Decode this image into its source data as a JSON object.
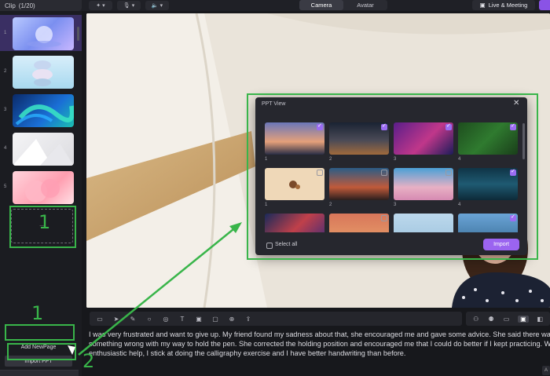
{
  "top_bar": {
    "clip_label": "Clip",
    "clip_count": "(1/20)",
    "tools": [
      {
        "icon": "effects-icon"
      },
      {
        "icon": "microphone-icon"
      },
      {
        "icon": "speaker-icon"
      }
    ],
    "mode_tabs": [
      "Camera",
      "Avatar"
    ],
    "active_mode": "Camera",
    "live_label": "Live & Meeting"
  },
  "sidebar": {
    "slides": [
      {
        "number": "1",
        "selected": true
      },
      {
        "number": "2",
        "selected": false
      },
      {
        "number": "3",
        "selected": false
      },
      {
        "number": "4",
        "selected": false
      },
      {
        "number": "5",
        "selected": false
      }
    ],
    "add_page_label": "Add NewPage",
    "import_ppt_label": "Import PPT",
    "plus_label": "+"
  },
  "annotations": {
    "marker_1_empty_slot": "1",
    "marker_1_buttons": "1",
    "marker_2": "2"
  },
  "ppt_dialog": {
    "title": "PPT View",
    "close_glyph": "✕",
    "slides": [
      {
        "label": "1",
        "checked": true
      },
      {
        "label": "2",
        "checked": true
      },
      {
        "label": "3",
        "checked": true
      },
      {
        "label": "4",
        "checked": true
      },
      {
        "label": "1",
        "checked": false
      },
      {
        "label": "2",
        "checked": false
      },
      {
        "label": "3",
        "checked": false
      },
      {
        "label": "4",
        "checked": true
      },
      {
        "label": "",
        "checked": false
      },
      {
        "label": "",
        "checked": false
      },
      {
        "label": "",
        "checked": false
      },
      {
        "label": "",
        "checked": true
      }
    ],
    "select_all_label": "Select all",
    "import_label": "Import"
  },
  "toolbar": {
    "tools": [
      "caption-icon",
      "pointer-icon",
      "pen-icon",
      "search-icon",
      "focus-icon",
      "text-icon",
      "image-icon",
      "screen-icon",
      "add-icon",
      "import-icon"
    ],
    "view_tools": [
      "person-icon",
      "people-icon",
      "display-icon",
      "layout-icon",
      "split-icon"
    ]
  },
  "script": {
    "text": "I was very frustrated and want to give up. My friend found my sadness about that, she encouraged me and gave some advice. She said there was something wrong with my way to hold the pen. She corrected the holding position and encouraged me that I could do better if I kept practicing. With her enthusiastic help, I stick at doing the calligraphy exercise and I have better handwriting than before."
  },
  "colors": {
    "accent": "#9b64f0",
    "annotation_green": "#39b54a",
    "background": "#17181c"
  }
}
